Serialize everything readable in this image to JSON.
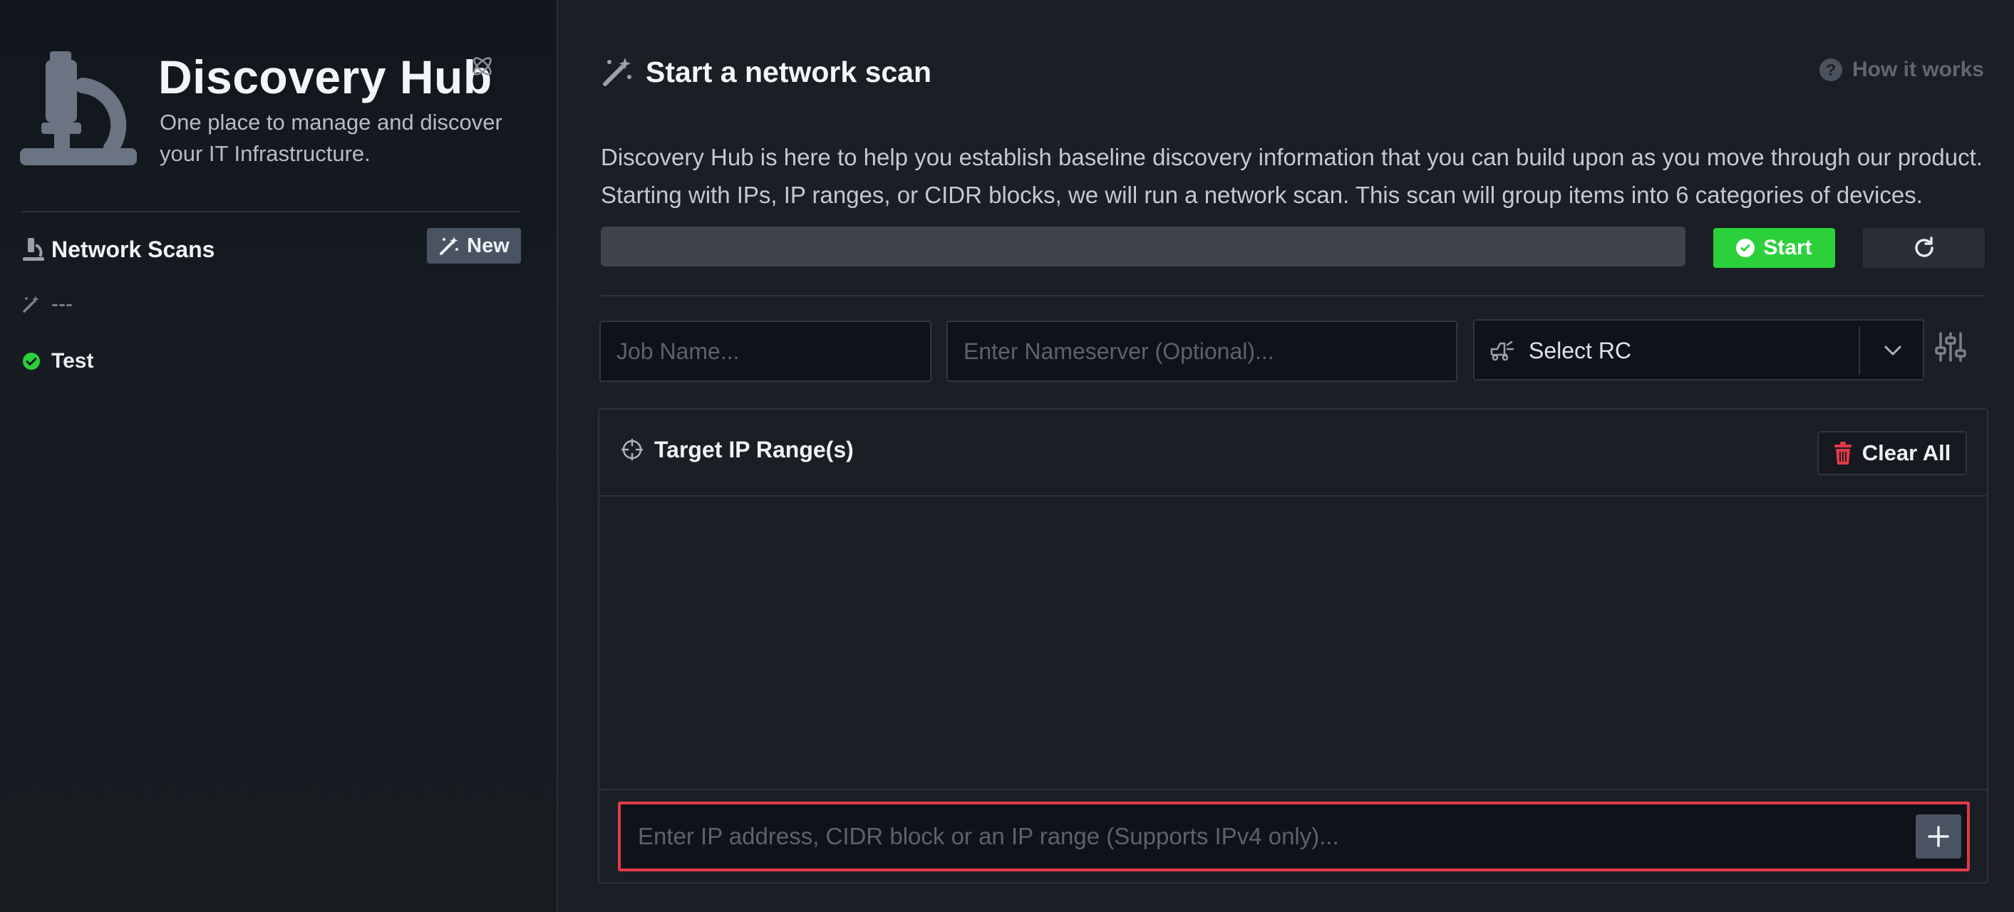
{
  "sidebar": {
    "brand": {
      "title": "Discovery Hub",
      "subtitle": "One place to manage and discover your IT Infrastructure."
    },
    "section_title": "Network Scans",
    "new_button": "New",
    "items": [
      {
        "label": "---",
        "status": "pending",
        "icon": "wand-icon"
      },
      {
        "label": "Test",
        "status": "completed",
        "icon": "check-circle-icon"
      }
    ]
  },
  "main": {
    "title": "Start a network scan",
    "help_link": "How it works",
    "description": "Discovery Hub is here to help you establish baseline discovery information that you can build upon as you move through our product. Starting with IPs, IP ranges, or CIDR blocks, we will run a network scan. This scan will group items into 6 categories of devices.",
    "start_button": "Start",
    "job_name_placeholder": "Job Name...",
    "nameserver_placeholder": "Enter Nameserver (Optional)...",
    "rc_select": "Select RC",
    "target_panel": {
      "title": "Target IP Range(s)",
      "clear_button": "Clear All",
      "ip_placeholder": "Enter IP address, CIDR block or an IP range (Supports IPv4 only)..."
    }
  },
  "colors": {
    "accent_green": "#2bd03b",
    "danger_red": "#e23a48",
    "background": "#1b1e24",
    "sidebar": "#12161d"
  }
}
